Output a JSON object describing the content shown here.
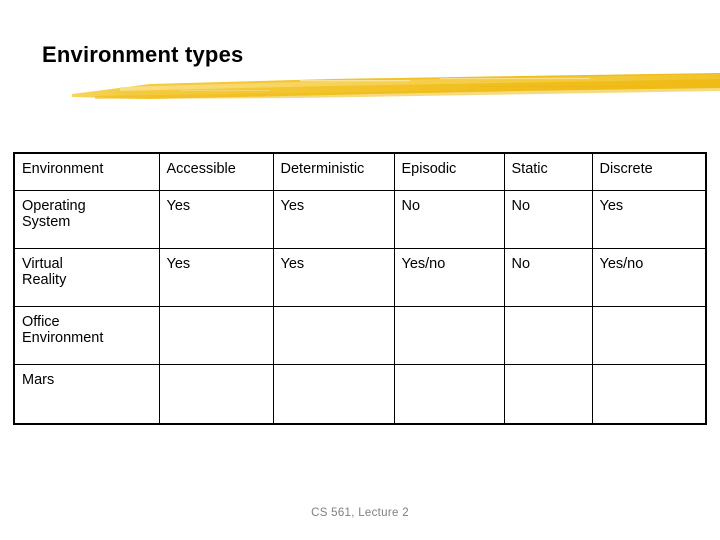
{
  "slide": {
    "title": "Environment types",
    "footer": "CS 561,  Lecture 2",
    "accent_color": "#F2C233",
    "text_color": "#000000",
    "footer_color": "#808080",
    "background_color": "#FFFFFF"
  },
  "table": {
    "headers": [
      "Environment",
      "Accessible",
      "Deterministic",
      "Episodic",
      "Static",
      "Discrete"
    ],
    "rows": [
      {
        "environment": "Operating\nSystem",
        "environment_line1": "Operating",
        "environment_line2": "System",
        "accessible": "Yes",
        "deterministic": "Yes",
        "episodic": "No",
        "static": "No",
        "discrete": "Yes"
      },
      {
        "environment": "Virtual\nReality",
        "environment_line1": "Virtual",
        "environment_line2": "Reality",
        "accessible": "Yes",
        "deterministic": "Yes",
        "episodic": "Yes/no",
        "static": "No",
        "discrete": "Yes/no"
      },
      {
        "environment": "Office\nEnvironment",
        "environment_line1": "Office",
        "environment_line2": "Environment",
        "accessible": "",
        "deterministic": "",
        "episodic": "",
        "static": "",
        "discrete": ""
      },
      {
        "environment": "Mars",
        "environment_line1": "Mars",
        "environment_line2": "",
        "accessible": "",
        "deterministic": "",
        "episodic": "",
        "static": "",
        "discrete": ""
      }
    ]
  }
}
